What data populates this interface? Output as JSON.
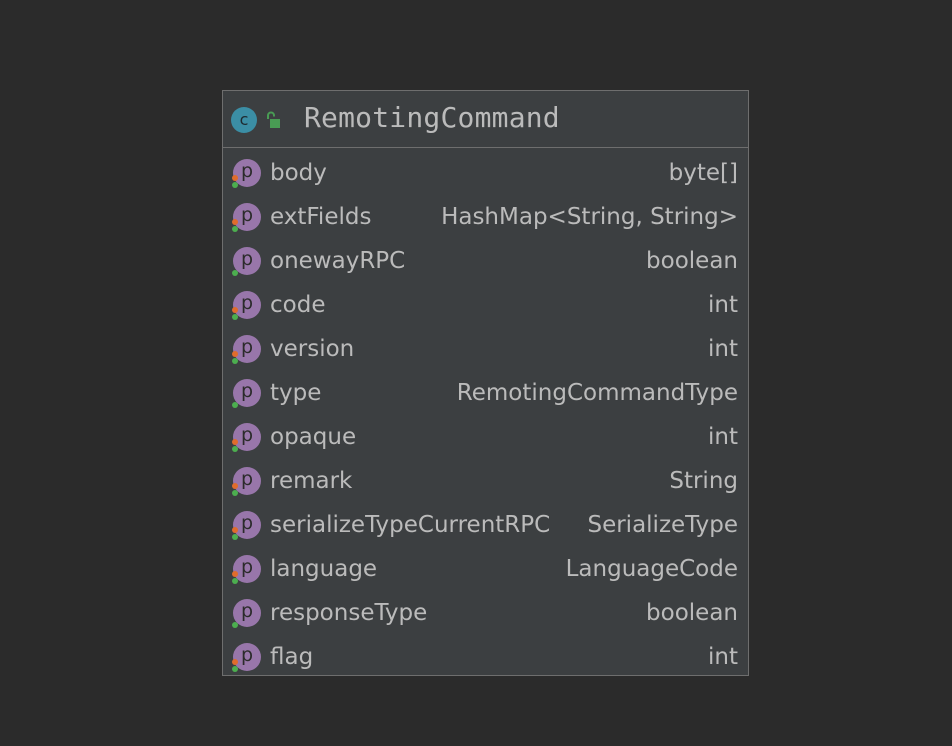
{
  "class": {
    "icon_letter": "c",
    "icon": "class-icon",
    "visibility_icon": "unlocked-icon",
    "name": "RemotingCommand"
  },
  "fields": [
    {
      "name": "body",
      "type": "byte[]",
      "icon_letter": "p",
      "has_getter": true,
      "has_setter": true
    },
    {
      "name": "extFields",
      "type": "HashMap<String, String>",
      "icon_letter": "p",
      "has_getter": true,
      "has_setter": true
    },
    {
      "name": "onewayRPC",
      "type": "boolean",
      "icon_letter": "p",
      "has_getter": false,
      "has_setter": true
    },
    {
      "name": "code",
      "type": "int",
      "icon_letter": "p",
      "has_getter": true,
      "has_setter": true
    },
    {
      "name": "version",
      "type": "int",
      "icon_letter": "p",
      "has_getter": true,
      "has_setter": true
    },
    {
      "name": "type",
      "type": "RemotingCommandType",
      "icon_letter": "p",
      "has_getter": false,
      "has_setter": true
    },
    {
      "name": "opaque",
      "type": "int",
      "icon_letter": "p",
      "has_getter": true,
      "has_setter": true
    },
    {
      "name": "remark",
      "type": "String",
      "icon_letter": "p",
      "has_getter": true,
      "has_setter": true
    },
    {
      "name": "serializeTypeCurrentRPC",
      "type": "SerializeType",
      "icon_letter": "p",
      "has_getter": true,
      "has_setter": true
    },
    {
      "name": "language",
      "type": "LanguageCode",
      "icon_letter": "p",
      "has_getter": true,
      "has_setter": true
    },
    {
      "name": "responseType",
      "type": "boolean",
      "icon_letter": "p",
      "has_getter": false,
      "has_setter": true
    },
    {
      "name": "flag",
      "type": "int",
      "icon_letter": "p",
      "has_getter": true,
      "has_setter": true
    }
  ],
  "colors": {
    "background": "#2b2b2b",
    "box": "#3c3f41",
    "border": "#6e6e6e",
    "text": "#bbbbbb",
    "class_icon": "#3b8ea5",
    "property_icon": "#9876aa",
    "getter_dot": "#e06c2c",
    "setter_dot": "#4cae4f",
    "lock_green": "#499c54"
  }
}
